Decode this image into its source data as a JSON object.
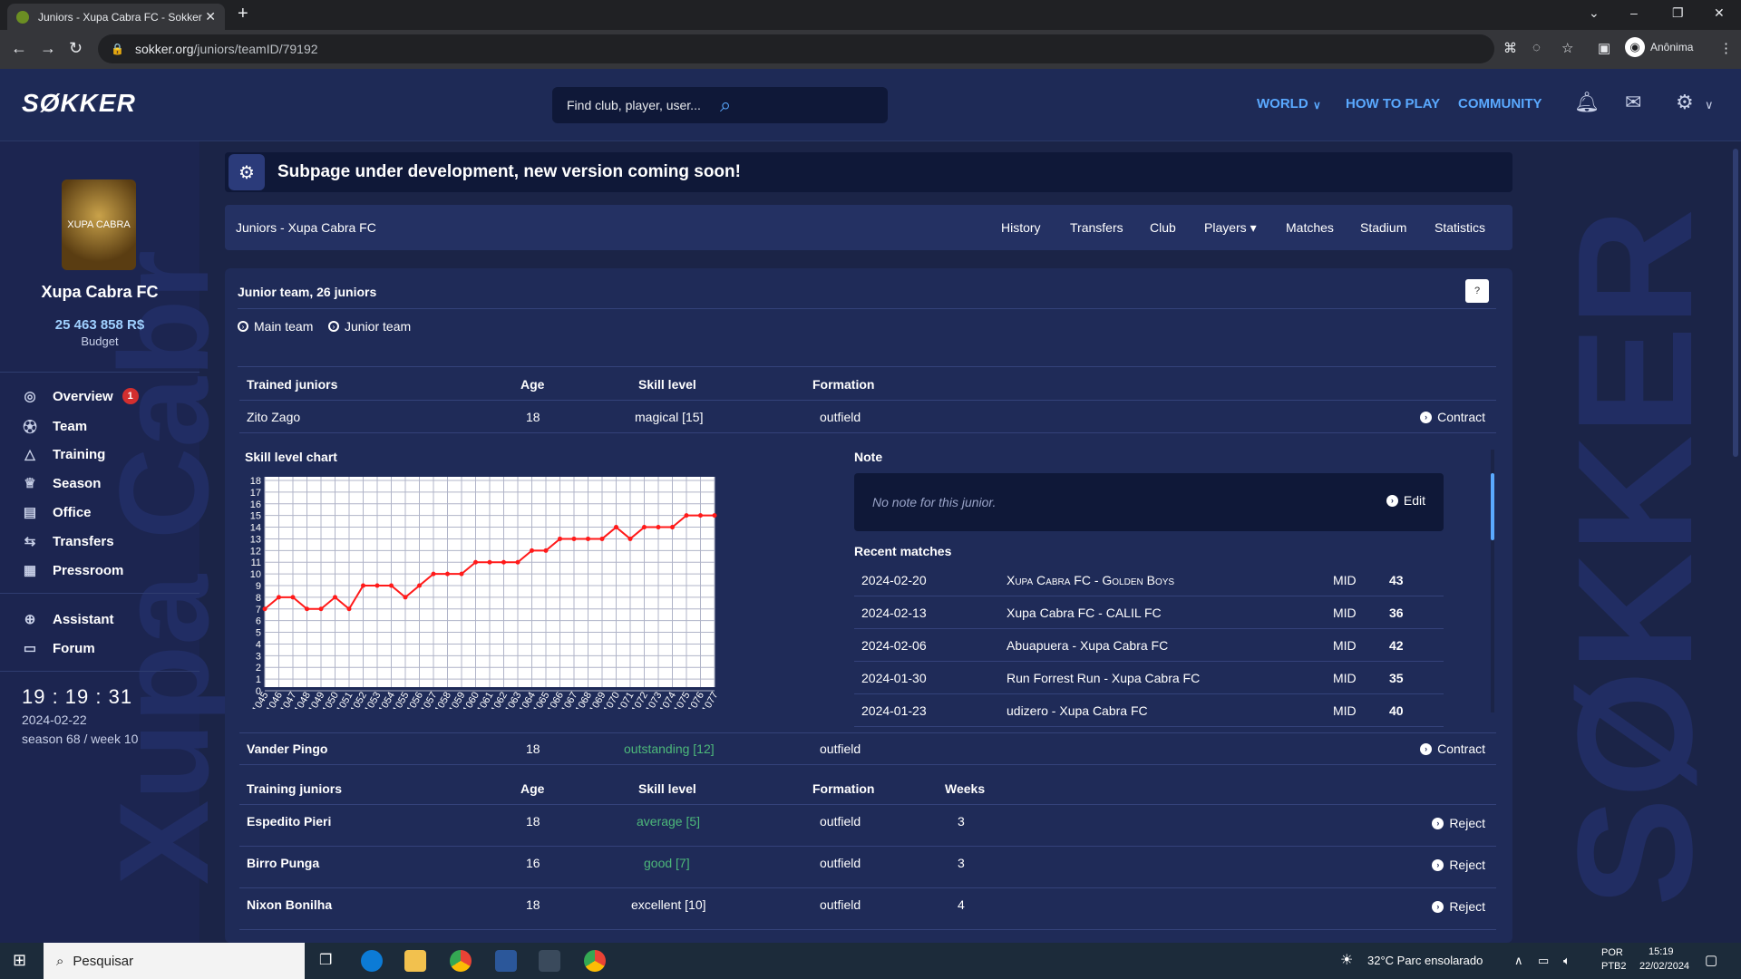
{
  "browser": {
    "tab_title": "Juniors - Xupa Cabra FC - Sokker",
    "url_host": "sokker.org",
    "url_path": "/juniors/teamID/79192",
    "profile": "Anônima"
  },
  "header": {
    "logo": "SØKKER",
    "search_placeholder": "Find club, player, user...",
    "nav": [
      "WORLD",
      "HOW TO PLAY",
      "COMMUNITY"
    ]
  },
  "sidebar": {
    "club_name": "Xupa Cabra FC",
    "budget": "25 463 858 R$",
    "budget_label": "Budget",
    "club_logo_text": "XUPA CABRA",
    "menu": [
      {
        "label": "Overview",
        "icon": "compass-icon",
        "badge": "1"
      },
      {
        "label": "Team",
        "icon": "ball-icon"
      },
      {
        "label": "Training",
        "icon": "cone-icon"
      },
      {
        "label": "Season",
        "icon": "trophy-icon"
      },
      {
        "label": "Office",
        "icon": "briefcase-icon"
      },
      {
        "label": "Transfers",
        "icon": "arrows-icon"
      },
      {
        "label": "Pressroom",
        "icon": "newspaper-icon"
      }
    ],
    "menu2": [
      {
        "label": "Assistant",
        "icon": "plus-circle-icon"
      },
      {
        "label": "Forum",
        "icon": "chat-icon"
      }
    ],
    "clock": "19 : 19 : 31",
    "date": "2024-02-22",
    "season": "season 68 / week 10",
    "bg_text": "Xupa Cabr"
  },
  "banner": "Subpage under development, new version coming soon!",
  "subnav": {
    "crumb": "Juniors - Xupa Cabra FC",
    "links": [
      "History",
      "Transfers",
      "Club",
      "Players ▾",
      "Matches",
      "Stadium",
      "Statistics"
    ]
  },
  "panel": {
    "title": "Junior team, 26 juniors",
    "help": "?",
    "radios": [
      "Main team",
      "Junior team"
    ],
    "trained_headers": [
      "Trained juniors",
      "Age",
      "Skill level",
      "Formation"
    ],
    "trained": [
      {
        "name": "Zito Zago",
        "age": "18",
        "skill": "magical [15]",
        "formation": "outfield",
        "action": "Contract"
      },
      {
        "name": "Vander Pingo",
        "age": "18",
        "skill": "outstanding [12]",
        "formation": "outfield",
        "action": "Contract"
      }
    ],
    "chart_title": "Skill level chart",
    "note_title": "Note",
    "note_text": "No note for this junior.",
    "edit": "Edit",
    "recent_title": "Recent matches",
    "matches": [
      {
        "date": "2024-02-20",
        "match": "Xupa Cabra FC - Golden Boys",
        "pos": "MID",
        "rating": "43"
      },
      {
        "date": "2024-02-13",
        "match": "Xupa Cabra FC - CALIL FC",
        "pos": "MID",
        "rating": "36"
      },
      {
        "date": "2024-02-06",
        "match": "Abuapuera - Xupa Cabra FC",
        "pos": "MID",
        "rating": "42"
      },
      {
        "date": "2024-01-30",
        "match": "Run Forrest Run - Xupa Cabra FC",
        "pos": "MID",
        "rating": "35"
      },
      {
        "date": "2024-01-23",
        "match": "udizero - Xupa Cabra FC",
        "pos": "MID",
        "rating": "40"
      }
    ],
    "training_headers": [
      "Training juniors",
      "Age",
      "Skill level",
      "Formation",
      "Weeks"
    ],
    "training": [
      {
        "name": "Espedito Pieri",
        "age": "18",
        "skill": "average [5]",
        "formation": "outfield",
        "weeks": "3",
        "action": "Reject",
        "green": true
      },
      {
        "name": "Birro Punga",
        "age": "16",
        "skill": "good [7]",
        "formation": "outfield",
        "weeks": "3",
        "action": "Reject",
        "green": true
      },
      {
        "name": "Nixon Bonilha",
        "age": "18",
        "skill": "excellent [10]",
        "formation": "outfield",
        "weeks": "4",
        "action": "Reject",
        "green": false
      }
    ]
  },
  "chart_data": {
    "type": "line",
    "x": [
      "1045",
      "1046",
      "1047",
      "1048",
      "1049",
      "1050",
      "1051",
      "1052",
      "1053",
      "1054",
      "1055",
      "1056",
      "1057",
      "1058",
      "1059",
      "1060",
      "1061",
      "1062",
      "1063",
      "1064",
      "1065",
      "1066",
      "1067",
      "1068",
      "1069",
      "1070",
      "1071",
      "1072",
      "1073",
      "1074",
      "1075",
      "1076",
      "1077"
    ],
    "values": [
      7,
      8,
      8,
      7,
      7,
      8,
      7,
      9,
      9,
      9,
      8,
      9,
      10,
      10,
      10,
      11,
      11,
      11,
      11,
      12,
      12,
      13,
      13,
      13,
      13,
      14,
      13,
      14,
      14,
      14,
      15,
      15,
      15
    ],
    "ylim": [
      0,
      18
    ],
    "grid": true,
    "color": "#ff1a1a"
  },
  "taskbar": {
    "search": "Pesquisar",
    "weather": "32°C  Parc ensolarado",
    "lang": "POR\nPTB2",
    "time": "15:19",
    "date": "22/02/2024"
  }
}
